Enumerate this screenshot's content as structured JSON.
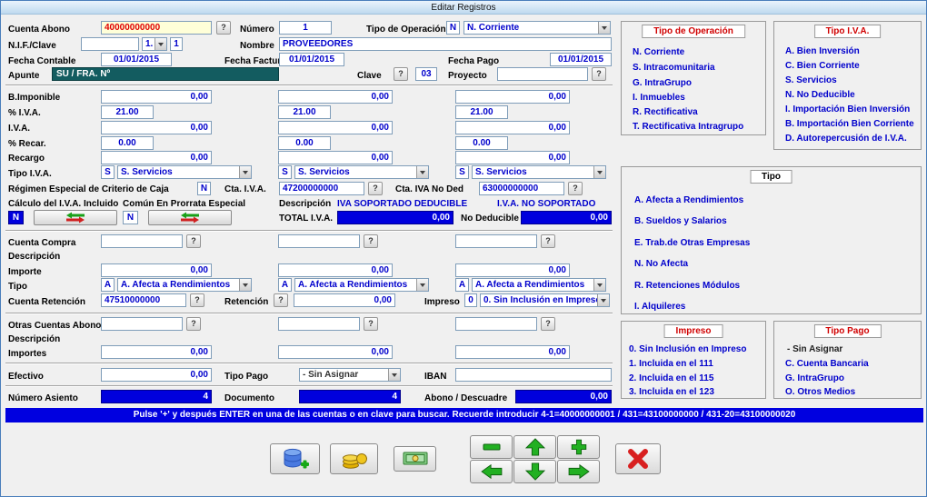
{
  "window": {
    "title": "Editar Registros"
  },
  "icons": {
    "help": "?"
  },
  "colors": {
    "value_blue": "#0000cc",
    "field_navy": "#0000dd",
    "banner_blue": "#0000e0",
    "group_title_red": "#d00000",
    "cuenta_abono_red": "#e00000",
    "apunte_teal": "#135c60"
  },
  "header": {
    "cuenta_abono_label": "Cuenta Abono",
    "cuenta_abono": "40000000000",
    "numero_label": "Número",
    "numero": "1",
    "tipo_operacion_label": "Tipo de Operación",
    "tipo_operacion_code": "N",
    "tipo_operacion_selected": "N. Corriente",
    "nif_label": "N.I.F./Clave",
    "nif": "",
    "nif_selector": "1.",
    "nif_num": "1",
    "nombre_label": "Nombre",
    "nombre": "PROVEEDORES",
    "fecha_contable_label": "Fecha Contable",
    "fecha_contable": "01/01/2015",
    "fecha_factura_label": "Fecha Factura",
    "fecha_factura": "01/01/2015",
    "fecha_pago_label": "Fecha Pago",
    "fecha_pago": "01/01/2015",
    "apunte_label": "Apunte",
    "apunte": "SU / FRA.  Nº",
    "clave_label": "Clave",
    "clave": "03",
    "proyecto_label": "Proyecto",
    "proyecto": ""
  },
  "iva": {
    "base_label": "B.Imponible",
    "base": [
      "0,00",
      "0,00",
      "0,00"
    ],
    "pct_label": "% I.V.A.",
    "pct": [
      "21.00",
      "21.00",
      "21.00"
    ],
    "importe_label": "I.V.A.",
    "importe": [
      "0,00",
      "0,00",
      "0,00"
    ],
    "recargo_pct_label": "% Recar.",
    "recargo_pct": [
      "0.00",
      "0.00",
      "0.00"
    ],
    "recargo_label": "Recargo",
    "recargo": [
      "0,00",
      "0,00",
      "0,00"
    ],
    "tipo_label": "Tipo I.V.A.",
    "tipo_codes": [
      "S",
      "S",
      "S"
    ],
    "tipo_selected": [
      "S. Servicios",
      "S. Servicios",
      "S. Servicios"
    ],
    "regimen_label": "Régimen Especial de Criterio de Caja",
    "regimen": "N",
    "cta_iva_label": "Cta. I.V.A.",
    "cta_iva": "47200000000",
    "cta_iva_no_ded_label": "Cta. IVA No Ded",
    "cta_iva_no_ded": "63000000000",
    "calculo_incluido_label": "Cálculo del I.V.A. Incluido",
    "prorrata_label": "Común En Prorrata Especial",
    "descripcion_label": "Descripción",
    "descripcion_1": "IVA SOPORTADO DEDUCIBLE",
    "descripcion_2": "I.V.A. NO SOPORTADO",
    "calculo_incluido": "N",
    "prorrata": "N",
    "total_label": "TOTAL I.V.A.",
    "total": "0,00",
    "no_deducible_label": "No Deducible",
    "no_deducible": "0,00"
  },
  "compra": {
    "cuenta_label": "Cuenta Compra",
    "cuentas": [
      "",
      "",
      ""
    ],
    "descripcion_label": "Descripción",
    "importe_label": "Importe",
    "importes": [
      "0,00",
      "0,00",
      "0,00"
    ],
    "tipo_label": "Tipo",
    "tipo_codes": [
      "A",
      "A",
      "A"
    ],
    "tipo_selected": [
      "A. Afecta a Rendimientos",
      "A. Afecta a Rendimientos",
      "A. Afecta a Rendimientos"
    ],
    "cuenta_retencion_label": "Cuenta Retención",
    "cuenta_retencion": "47510000000",
    "retencion_label": "Retención",
    "retencion": "0,00",
    "impreso_label": "Impreso",
    "impreso_code": "0",
    "impreso_selected": "0. Sin Inclusión en Impreso"
  },
  "otras": {
    "label": "Otras Cuentas Abono",
    "cuentas": [
      "",
      "",
      ""
    ],
    "descripcion_label": "Descripción",
    "importes_label": "Importes",
    "importes": [
      "0,00",
      "0,00",
      "0,00"
    ]
  },
  "pago": {
    "efectivo_label": "Efectivo",
    "efectivo": "0,00",
    "tipo_pago_label": "Tipo Pago",
    "tipo_pago_selected": "- Sin Asignar",
    "iban_label": "IBAN",
    "iban": ""
  },
  "resumen": {
    "numero_asiento_label": "Número Asiento",
    "numero_asiento": "4",
    "documento_label": "Documento",
    "documento": "4",
    "abono_descuadre_label": "Abono / Descuadre",
    "abono_descuadre": "0,00"
  },
  "banner": "Pulse '+' y después ENTER en una de las cuentas o en clave para buscar. Recuerde introducir 4-1=40000000001 / 431=43100000000 / 431-20=43100000020",
  "panels": {
    "tipo_operacion": {
      "title": "Tipo de Operación",
      "items": [
        "N. Corriente",
        "S. Intracomunitaria",
        "G. IntraGrupo",
        "I. Inmuebles",
        "R. Rectificativa",
        "T. Rectificativa Intragrupo"
      ]
    },
    "tipo_iva": {
      "title": "Tipo I.V.A.",
      "items": [
        "A. Bien Inversión",
        "C. Bien Corriente",
        "S. Servicios",
        "N. No Deducible",
        "I. Importación Bien Inversión",
        "B. Importación Bien Corriente",
        "D. Autorepercusión de I.V.A."
      ]
    },
    "tipo": {
      "title": "Tipo",
      "items": [
        "A. Afecta a Rendimientos",
        "B. Sueldos y Salarios",
        "E. Trab.de Otras Empresas",
        "N. No Afecta",
        "R. Retenciones Módulos",
        "I. Alquileres"
      ]
    },
    "impreso": {
      "title": "Impreso",
      "items": [
        "0. Sin Inclusión en Impreso",
        "1. Incluida en el 111",
        "2. Incluida en el 115",
        "3. Incluida en el 123"
      ]
    },
    "tipo_pago": {
      "title": "Tipo Pago",
      "items": [
        "- Sin Asignar",
        "C. Cuenta Bancaria",
        "G. IntraGrupo",
        "O. Otros Medios"
      ]
    }
  }
}
